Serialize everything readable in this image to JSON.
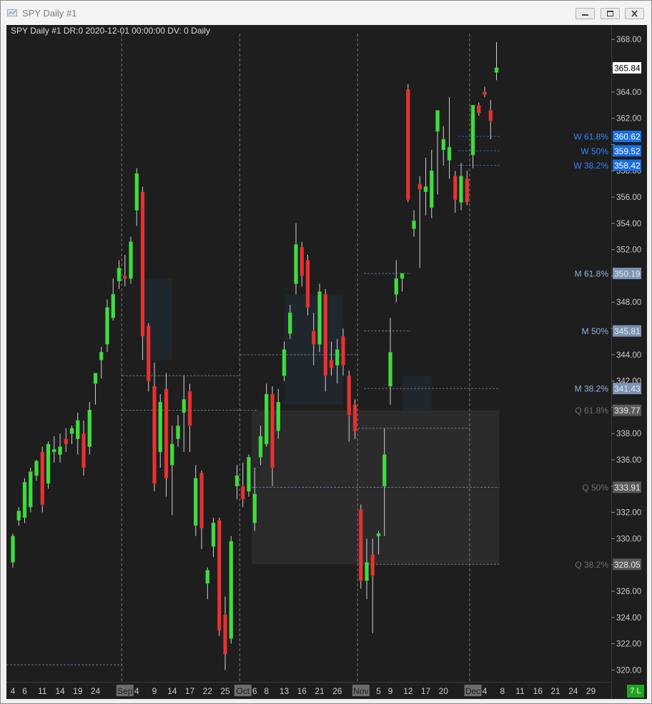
{
  "window": {
    "title": "SPY  Daily  #1",
    "controls": [
      "minimize",
      "maximize",
      "close"
    ]
  },
  "chart_header": "SPY  Daily  #1 DR:0 2020-12-01 00:00:00 DV: 0 Daily",
  "status_badge": "7 L",
  "colors": {
    "background": "#1e1e1e",
    "bull": "#3fdc3f",
    "bear": "#e53333",
    "axis_text": "#c8c8c8",
    "weekly": "#2f7fe6",
    "monthly": "#7a9cc6",
    "quarterly": "#6e6e6e"
  },
  "chart_data": {
    "type": "candlestick",
    "symbol": "SPY",
    "y_range": [
      319.1,
      369.1
    ],
    "y_ticks": [
      320,
      322,
      324,
      326,
      328,
      330,
      332,
      334,
      336,
      338,
      340,
      342,
      344,
      346,
      348,
      350,
      352,
      354,
      356,
      358,
      360,
      362,
      364,
      366,
      368
    ],
    "y_tick_labels": [
      "320.00",
      "322.00",
      "324.00",
      "326.00",
      "328.00",
      "330.00",
      "332.00",
      "334.00",
      "336.00",
      "338.00",
      "",
      "342.00",
      "344.00",
      "",
      "348.00",
      "",
      "352.00",
      "354.00",
      "356.00",
      "358.00",
      "",
      "362.00",
      "364.00",
      "366.00",
      "368.00"
    ],
    "x_labels": [
      {
        "i": 0,
        "text": "4"
      },
      {
        "i": 2,
        "text": "6"
      },
      {
        "i": 5,
        "text": "11"
      },
      {
        "i": 8,
        "text": "14"
      },
      {
        "i": 11,
        "text": "19"
      },
      {
        "i": 14,
        "text": "24"
      },
      {
        "i": 19,
        "text": "Sep",
        "highlight": true
      },
      {
        "i": 21,
        "text": "4"
      },
      {
        "i": 24,
        "text": "9"
      },
      {
        "i": 27,
        "text": "14"
      },
      {
        "i": 30,
        "text": "17"
      },
      {
        "i": 33,
        "text": "22"
      },
      {
        "i": 36,
        "text": "25"
      },
      {
        "i": 39,
        "text": "Oct",
        "highlight": true
      },
      {
        "i": 41,
        "text": "6"
      },
      {
        "i": 43,
        "text": "8"
      },
      {
        "i": 46,
        "text": "13"
      },
      {
        "i": 49,
        "text": "16"
      },
      {
        "i": 52,
        "text": "21"
      },
      {
        "i": 55,
        "text": "26"
      },
      {
        "i": 59,
        "text": "Nov",
        "highlight": true
      },
      {
        "i": 62,
        "text": "5"
      },
      {
        "i": 64,
        "text": "9"
      },
      {
        "i": 67,
        "text": "12"
      },
      {
        "i": 70,
        "text": "17"
      },
      {
        "i": 73,
        "text": "20"
      },
      {
        "i": 78,
        "text": "Dec",
        "highlight": true
      },
      {
        "i": 80,
        "text": "4"
      },
      {
        "i": 83,
        "text": "8"
      },
      {
        "i": 86,
        "text": "11"
      },
      {
        "i": 89,
        "text": "16"
      },
      {
        "i": 92,
        "text": "21"
      },
      {
        "i": 95,
        "text": "24"
      },
      {
        "i": 98,
        "text": "29"
      }
    ],
    "month_separators": [
      19,
      39,
      59,
      78
    ],
    "candles": [
      {
        "i": 0,
        "o": 328.2,
        "h": 330.4,
        "l": 327.8,
        "c": 330.2
      },
      {
        "i": 1,
        "o": 331.4,
        "h": 332.4,
        "l": 331.0,
        "c": 332.1
      },
      {
        "i": 2,
        "o": 331.6,
        "h": 334.6,
        "l": 331.2,
        "c": 334.3
      },
      {
        "i": 3,
        "o": 332.4,
        "h": 335.4,
        "l": 332.0,
        "c": 335.1
      },
      {
        "i": 4,
        "o": 334.8,
        "h": 336.0,
        "l": 334.4,
        "c": 335.9
      },
      {
        "i": 5,
        "o": 336.6,
        "h": 337.0,
        "l": 332.0,
        "c": 332.6
      },
      {
        "i": 6,
        "o": 334.2,
        "h": 337.4,
        "l": 333.8,
        "c": 337.2
      },
      {
        "i": 7,
        "o": 336.6,
        "h": 337.8,
        "l": 335.8,
        "c": 336.8
      },
      {
        "i": 8,
        "o": 336.4,
        "h": 338.0,
        "l": 335.8,
        "c": 337.0
      },
      {
        "i": 9,
        "o": 337.6,
        "h": 338.4,
        "l": 336.6,
        "c": 337.2
      },
      {
        "i": 10,
        "o": 338.0,
        "h": 338.6,
        "l": 337.2,
        "c": 338.4
      },
      {
        "i": 11,
        "o": 337.6,
        "h": 339.6,
        "l": 336.4,
        "c": 339.0
      },
      {
        "i": 12,
        "o": 338.0,
        "h": 339.0,
        "l": 334.8,
        "c": 335.4
      },
      {
        "i": 13,
        "o": 337.0,
        "h": 340.4,
        "l": 336.4,
        "c": 339.8
      },
      {
        "i": 14,
        "o": 341.8,
        "h": 342.6,
        "l": 340.2,
        "c": 342.6
      },
      {
        "i": 15,
        "o": 343.6,
        "h": 344.6,
        "l": 342.2,
        "c": 344.2
      },
      {
        "i": 16,
        "o": 344.8,
        "h": 348.2,
        "l": 344.2,
        "c": 347.6
      },
      {
        "i": 17,
        "o": 346.8,
        "h": 349.8,
        "l": 346.6,
        "c": 348.6
      },
      {
        "i": 18,
        "o": 349.6,
        "h": 351.2,
        "l": 349.0,
        "c": 350.6
      },
      {
        "i": 19,
        "o": 350.0,
        "h": 351.6,
        "l": 349.2,
        "c": 349.8
      },
      {
        "i": 20,
        "o": 349.8,
        "h": 353.0,
        "l": 349.4,
        "c": 352.6
      },
      {
        "i": 21,
        "o": 355.0,
        "h": 358.2,
        "l": 353.8,
        "c": 357.8
      },
      {
        "i": 22,
        "o": 356.4,
        "h": 356.8,
        "l": 343.6,
        "c": 345.4
      },
      {
        "i": 23,
        "o": 346.2,
        "h": 346.4,
        "l": 341.2,
        "c": 342.0
      },
      {
        "i": 24,
        "o": 341.6,
        "h": 343.4,
        "l": 333.6,
        "c": 334.2
      },
      {
        "i": 25,
        "o": 336.6,
        "h": 341.0,
        "l": 335.4,
        "c": 340.4
      },
      {
        "i": 26,
        "o": 341.4,
        "h": 342.6,
        "l": 333.2,
        "c": 334.6
      },
      {
        "i": 27,
        "o": 335.6,
        "h": 338.6,
        "l": 331.8,
        "c": 337.2
      },
      {
        "i": 28,
        "o": 337.6,
        "h": 339.4,
        "l": 337.0,
        "c": 338.6
      },
      {
        "i": 29,
        "o": 339.6,
        "h": 342.4,
        "l": 336.6,
        "c": 340.6
      },
      {
        "i": 30,
        "o": 341.2,
        "h": 341.8,
        "l": 336.6,
        "c": 338.6
      },
      {
        "i": 31,
        "o": 331.0,
        "h": 335.6,
        "l": 330.2,
        "c": 334.6
      },
      {
        "i": 32,
        "o": 335.0,
        "h": 335.2,
        "l": 329.2,
        "c": 330.8
      },
      {
        "i": 33,
        "o": 326.6,
        "h": 327.8,
        "l": 325.4,
        "c": 327.6
      },
      {
        "i": 34,
        "o": 329.4,
        "h": 331.6,
        "l": 328.6,
        "c": 331.2
      },
      {
        "i": 35,
        "o": 331.4,
        "h": 331.6,
        "l": 322.6,
        "c": 323.0
      },
      {
        "i": 36,
        "o": 324.2,
        "h": 325.6,
        "l": 320.0,
        "c": 321.2
      },
      {
        "i": 37,
        "o": 322.4,
        "h": 330.2,
        "l": 322.0,
        "c": 329.8
      },
      {
        "i": 38,
        "o": 334.0,
        "h": 335.6,
        "l": 333.0,
        "c": 334.8
      },
      {
        "i": 39,
        "o": 334.0,
        "h": 335.8,
        "l": 332.4,
        "c": 333.0
      },
      {
        "i": 40,
        "o": 333.6,
        "h": 336.4,
        "l": 333.2,
        "c": 336.2
      },
      {
        "i": 41,
        "o": 331.2,
        "h": 335.4,
        "l": 330.6,
        "c": 333.4
      },
      {
        "i": 42,
        "o": 336.2,
        "h": 338.6,
        "l": 335.6,
        "c": 337.8
      },
      {
        "i": 43,
        "o": 337.2,
        "h": 341.8,
        "l": 337.0,
        "c": 341.0
      },
      {
        "i": 44,
        "o": 341.0,
        "h": 341.6,
        "l": 334.0,
        "c": 335.4
      },
      {
        "i": 45,
        "o": 338.2,
        "h": 341.4,
        "l": 337.6,
        "c": 340.4
      },
      {
        "i": 46,
        "o": 342.4,
        "h": 345.0,
        "l": 342.0,
        "c": 344.4
      },
      {
        "i": 47,
        "o": 345.6,
        "h": 347.8,
        "l": 345.2,
        "c": 347.2
      },
      {
        "i": 48,
        "o": 349.4,
        "h": 354.0,
        "l": 348.6,
        "c": 352.4
      },
      {
        "i": 49,
        "o": 352.2,
        "h": 352.6,
        "l": 349.2,
        "c": 350.0
      },
      {
        "i": 50,
        "o": 351.2,
        "h": 351.6,
        "l": 347.0,
        "c": 347.6
      },
      {
        "i": 51,
        "o": 345.8,
        "h": 347.2,
        "l": 343.2,
        "c": 344.8
      },
      {
        "i": 52,
        "o": 344.8,
        "h": 349.4,
        "l": 344.2,
        "c": 348.8
      },
      {
        "i": 53,
        "o": 348.6,
        "h": 349.0,
        "l": 341.2,
        "c": 342.4
      },
      {
        "i": 54,
        "o": 343.6,
        "h": 345.0,
        "l": 342.4,
        "c": 343.0
      },
      {
        "i": 55,
        "o": 343.2,
        "h": 345.2,
        "l": 341.8,
        "c": 344.4
      },
      {
        "i": 56,
        "o": 345.4,
        "h": 346.0,
        "l": 342.4,
        "c": 343.2
      },
      {
        "i": 57,
        "o": 342.4,
        "h": 342.8,
        "l": 337.4,
        "c": 339.4
      },
      {
        "i": 58,
        "o": 340.2,
        "h": 340.6,
        "l": 337.6,
        "c": 338.2
      },
      {
        "i": 59,
        "o": 332.2,
        "h": 332.6,
        "l": 326.2,
        "c": 326.8
      },
      {
        "i": 60,
        "o": 326.8,
        "h": 330.0,
        "l": 325.4,
        "c": 328.2
      },
      {
        "i": 61,
        "o": 328.8,
        "h": 330.0,
        "l": 322.8,
        "c": 327.2
      },
      {
        "i": 62,
        "o": 330.2,
        "h": 330.6,
        "l": 328.8,
        "c": 330.4
      },
      {
        "i": 63,
        "o": 334.0,
        "h": 338.4,
        "l": 330.2,
        "c": 336.4
      },
      {
        "i": 64,
        "o": 341.6,
        "h": 346.8,
        "l": 340.2,
        "c": 344.2
      },
      {
        "i": 65,
        "o": 348.6,
        "h": 351.2,
        "l": 348.0,
        "c": 349.8
      },
      {
        "i": 66,
        "o": 349.8,
        "h": 350.2,
        "l": 348.8,
        "c": 350.2
      },
      {
        "i": 67,
        "o": 364.2,
        "h": 364.6,
        "l": 355.6,
        "c": 355.8
      },
      {
        "i": 68,
        "o": 353.6,
        "h": 355.0,
        "l": 353.0,
        "c": 354.2
      },
      {
        "i": 69,
        "o": 357.0,
        "h": 357.6,
        "l": 350.6,
        "c": 356.6
      },
      {
        "i": 70,
        "o": 356.4,
        "h": 359.0,
        "l": 354.6,
        "c": 356.8
      },
      {
        "i": 71,
        "o": 355.2,
        "h": 359.6,
        "l": 354.4,
        "c": 358.0
      },
      {
        "i": 72,
        "o": 361.0,
        "h": 362.6,
        "l": 356.2,
        "c": 362.6
      },
      {
        "i": 73,
        "o": 359.6,
        "h": 361.4,
        "l": 358.4,
        "c": 360.4
      },
      {
        "i": 74,
        "o": 358.8,
        "h": 363.6,
        "l": 357.4,
        "c": 359.8
      },
      {
        "i": 75,
        "o": 357.6,
        "h": 358.0,
        "l": 354.8,
        "c": 355.8
      },
      {
        "i": 76,
        "o": 355.6,
        "h": 358.6,
        "l": 355.0,
        "c": 357.6
      },
      {
        "i": 77,
        "o": 357.4,
        "h": 358.0,
        "l": 355.4,
        "c": 355.6
      },
      {
        "i": 78,
        "o": 359.2,
        "h": 363.0,
        "l": 358.2,
        "c": 363.0
      },
      {
        "i": 79,
        "o": 363.0,
        "h": 363.2,
        "l": 362.2,
        "c": 362.4
      },
      {
        "i": 80,
        "o": 364.0,
        "h": 364.4,
        "l": 363.6,
        "c": 363.8
      },
      {
        "i": 81,
        "o": 362.6,
        "h": 363.4,
        "l": 360.4,
        "c": 361.8
      },
      {
        "i": 82,
        "o": 365.5,
        "h": 367.8,
        "l": 364.9,
        "c": 365.84
      }
    ],
    "current_price": {
      "value": 365.84,
      "label": "365.84"
    },
    "levels": [
      {
        "name": "W 61.8%",
        "value": 360.62,
        "label": "360.62",
        "kind": "weekly"
      },
      {
        "name": "W 50%",
        "value": 359.52,
        "label": "359.52",
        "kind": "weekly"
      },
      {
        "name": "W 38.2%",
        "value": 358.42,
        "label": "358.42",
        "kind": "weekly"
      },
      {
        "name": "M 61.8%",
        "value": 350.19,
        "label": "350.19",
        "kind": "monthly"
      },
      {
        "name": "M 50%",
        "value": 345.81,
        "label": "345.81",
        "kind": "monthly"
      },
      {
        "name": "M 38.2%",
        "value": 341.43,
        "label": "341.43",
        "kind": "monthly"
      },
      {
        "name": "Q 61.8%",
        "value": 339.77,
        "label": "339.77",
        "kind": "quarterly"
      },
      {
        "name": "Q 50%",
        "value": 333.91,
        "label": "333.91",
        "kind": "quarterly"
      },
      {
        "name": "Q 38.2%",
        "value": 328.05,
        "label": "328.05",
        "kind": "quarterly"
      }
    ],
    "grid": false
  }
}
